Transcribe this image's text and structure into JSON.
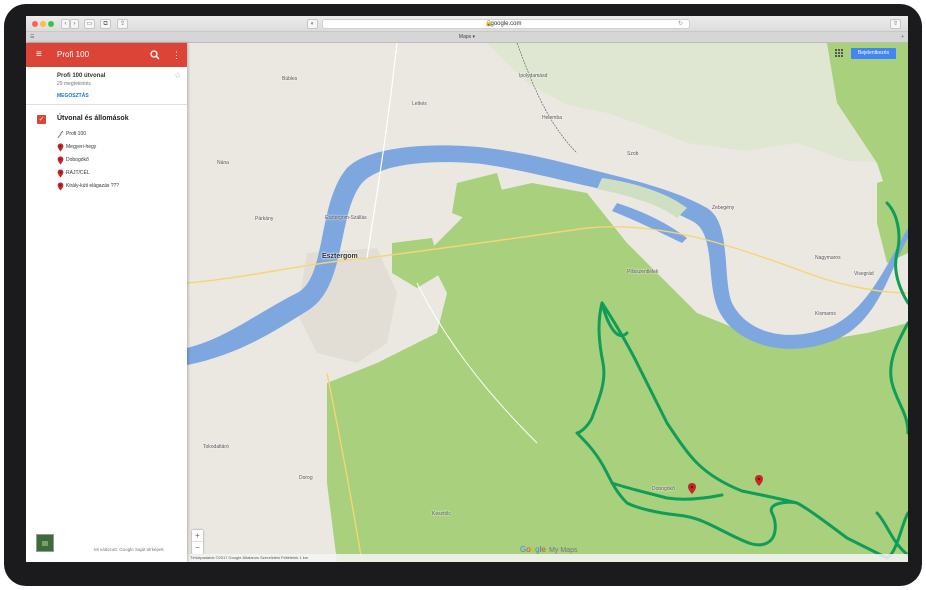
{
  "browser": {
    "url": "google.com",
    "tab_title": "Maps ▾"
  },
  "sidebar": {
    "header_title": "Profi 100",
    "map_name": "Profi 100 útvonal",
    "map_subtitle": "29 megtekintés",
    "share_label": "MEGOSZTÁS",
    "layer_title": "Útvonal és állomások",
    "items": [
      {
        "icon": "route-line-icon",
        "label": "Profi 100"
      },
      {
        "icon": "map-pin-icon",
        "label": "Megyeri-hegy"
      },
      {
        "icon": "map-pin-icon",
        "label": "Dobogókő"
      },
      {
        "icon": "map-pin-icon",
        "label": "RAJT/CÉL"
      },
      {
        "icon": "map-pin-icon",
        "label": "Király-kúti elágazás ???"
      }
    ],
    "footer_text": "Mi változott: Google Saját térképek"
  },
  "map": {
    "signin_label": "Bejelentkezés",
    "zoom_in": "+",
    "zoom_out": "−",
    "logo_google": "Google",
    "logo_mymaps": "My Maps",
    "attribution": "Térképadatok ©2017 Google   Általános Szerződési Feltételek   1 km",
    "labels": {
      "esztergom": "Esztergom",
      "esztergom_szallas": "Esztergom-Szállás",
      "dobogoko": "Dobogókő",
      "pilisszentlelek": "Pilisszentlélek",
      "nagymaros": "Nagymaros",
      "zebegeny": "Zebegény",
      "szob": "Szob",
      "kismaros": "Kismaros",
      "visegrad": "Visegrád",
      "letkes": "Letkés",
      "ipolydamasd": "Ipolydamásd",
      "helemba": "Helemba",
      "parkany": "Párkány",
      "nana": "Nána",
      "bubles": "Búbles",
      "tokod": "Tokodaltáró",
      "dorog": "Dorog",
      "kesztolc": "Kesztölc",
      "dobogoko_map": "Dobogókő",
      "pilisszentkereszt": "Pilisszentkereszt"
    }
  },
  "colors": {
    "header_red": "#db4437",
    "route_green": "#0f9d58",
    "water": "#7ea7e0",
    "forest": "#a8d07d",
    "land": "#ebe8e2",
    "signin_blue": "#4285f4"
  }
}
